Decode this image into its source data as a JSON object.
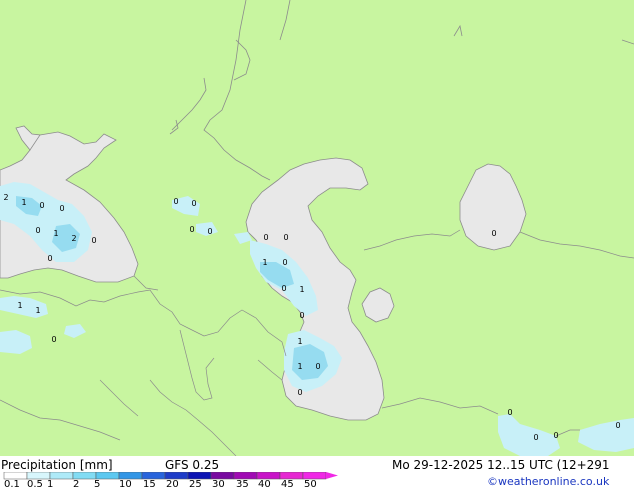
{
  "title": "Precipitation [mm]",
  "model": "GFS 0.25",
  "datetime": "Mo 29-12-2025 12..15 UTC (12+291",
  "credit": "©weatheronline.co.uk",
  "colors": {
    "land": "#c8f5a0",
    "sea": "#e8e8e8",
    "precip_light": "#c8f0f8",
    "precip_medium": "#96dcf0",
    "coastline": "#8c8c8c",
    "border": "#8c8c8c"
  },
  "scale": {
    "labels": [
      "0.1",
      "0.5",
      "1",
      "2",
      "5",
      "10",
      "15",
      "20",
      "25",
      "30",
      "35",
      "40",
      "45",
      "50"
    ],
    "colors": [
      "#ffffff",
      "#d8f6fc",
      "#aeeaf8",
      "#82dcf4",
      "#5cc8f0",
      "#3296e6",
      "#2864dc",
      "#1e3cc8",
      "#0c14b4",
      "#780aa0",
      "#a00ab4",
      "#c814c8",
      "#e628d2",
      "#f028e6"
    ]
  },
  "map_labels": [
    {
      "text": "2"
    },
    {
      "text": "1"
    },
    {
      "text": "0"
    },
    {
      "text": "0"
    },
    {
      "text": "0"
    },
    {
      "text": "1"
    },
    {
      "text": "2"
    },
    {
      "text": "0"
    },
    {
      "text": "0"
    },
    {
      "text": "1"
    },
    {
      "text": "1"
    },
    {
      "text": "0"
    },
    {
      "text": "0"
    },
    {
      "text": "0"
    },
    {
      "text": "0"
    },
    {
      "text": "0"
    },
    {
      "text": "0"
    },
    {
      "text": "0"
    },
    {
      "text": "1"
    },
    {
      "text": "0"
    },
    {
      "text": "0"
    },
    {
      "text": "1"
    },
    {
      "text": "0"
    },
    {
      "text": "1"
    },
    {
      "text": "1"
    },
    {
      "text": "0"
    },
    {
      "text": "0"
    },
    {
      "text": "0"
    },
    {
      "text": "0"
    },
    {
      "text": "0"
    },
    {
      "text": "0"
    },
    {
      "text": "0"
    }
  ]
}
